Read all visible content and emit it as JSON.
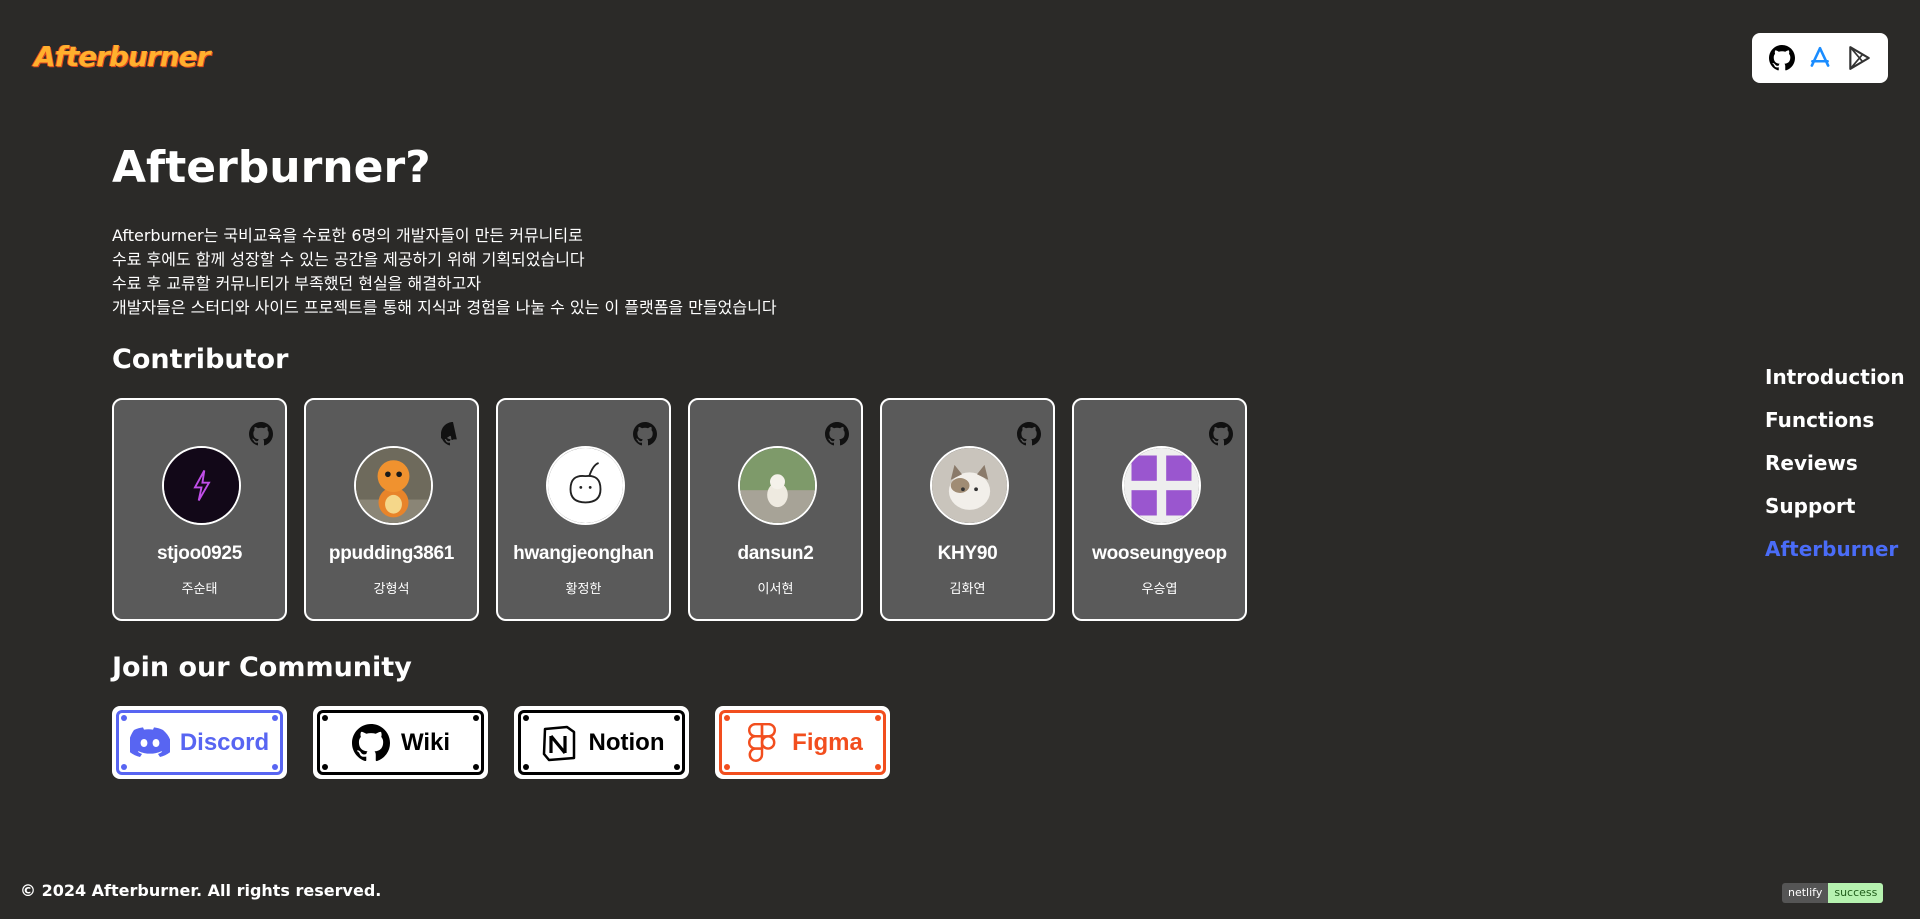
{
  "brand": {
    "logo_text": "Afterburner"
  },
  "store_links": [
    {
      "icon": "github-icon",
      "color": "#000000"
    },
    {
      "icon": "app-store-icon",
      "color": "#1a8cff"
    },
    {
      "icon": "google-play-icon",
      "color": "#333333"
    }
  ],
  "intro": {
    "title": "Afterburner?",
    "lines": [
      "Afterburner는 국비교육을 수료한 6명의 개발자들이 만든 커뮤니티로",
      "수료 후에도 함께 성장할 수 있는 공간을 제공하기 위해 기획되었습니다",
      "수료 후 교류할 커뮤니티가 부족했던 현실을 해결하고자",
      "개발자들은 스터디와 사이드 프로젝트를 통해 지식과 경험을 나눌 수 있는 이 플랫폼을 만들었습니다"
    ]
  },
  "contributors": {
    "heading": "Contributor",
    "people": [
      {
        "username": "stjoo0925",
        "name": "주순태"
      },
      {
        "username": "ppudding3861",
        "name": "강형석"
      },
      {
        "username": "hwangjeonghan",
        "name": "황정한"
      },
      {
        "username": "dansun2",
        "name": "이서현"
      },
      {
        "username": "KHY90",
        "name": "김화연"
      },
      {
        "username": "wooseungyeop",
        "name": "우승엽"
      }
    ]
  },
  "community": {
    "heading": "Join our Community",
    "links": [
      {
        "label": "Discord",
        "color": "#5865f2"
      },
      {
        "label": "Wiki",
        "color": "#000000"
      },
      {
        "label": "Notion",
        "color": "#000000"
      },
      {
        "label": "Figma",
        "color": "#f24e1e"
      }
    ]
  },
  "side_nav": {
    "items": [
      "Introduction",
      "Functions",
      "Reviews",
      "Support",
      "Afterburner"
    ],
    "active": "Afterburner",
    "active_color": "#4a6cf7"
  },
  "footer": {
    "copyright": "© 2024 Afterburner. All rights reserved."
  },
  "deploy_badge": {
    "label": "netlify",
    "status": "success"
  }
}
